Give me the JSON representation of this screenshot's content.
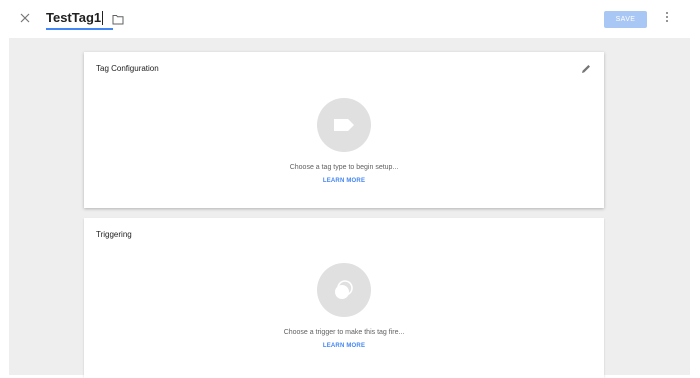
{
  "header": {
    "tag_name": "TestTag1",
    "save_label": "SAVE",
    "icons": [
      "close-icon",
      "folder-icon",
      "more-vert-icon"
    ]
  },
  "tag_configuration": {
    "title": "Tag Configuration",
    "hint": "Choose a tag type to begin setup...",
    "learn_more": "LEARN MORE",
    "icons": [
      "edit-icon",
      "tag-icon"
    ]
  },
  "triggering": {
    "title": "Triggering",
    "hint": "Choose a trigger to make this tag fire...",
    "learn_more": "LEARN MORE",
    "icons": [
      "trigger-icon"
    ]
  },
  "colors": {
    "accent": "#4285f4",
    "save_disabled": "#a9c7f5",
    "background": "#eeeeee",
    "placeholder_circle": "#e0e0e0"
  }
}
